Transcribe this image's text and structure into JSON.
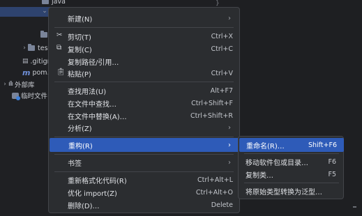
{
  "tree": {
    "rows": [
      {
        "label": "java"
      },
      {
        "label": ""
      },
      {
        "label": ""
      },
      {
        "label": "tes"
      },
      {
        "label": ".gitign"
      },
      {
        "label": "pom.x"
      },
      {
        "label": "外部库"
      },
      {
        "label": "临时文件"
      }
    ]
  },
  "editor": {
    "mark": "}"
  },
  "menu": {
    "new": {
      "label": "新建(N)"
    },
    "cut": {
      "label": "剪切(T)",
      "shortcut": "Ctrl+X"
    },
    "copy": {
      "label": "复制(C)",
      "shortcut": "Ctrl+C"
    },
    "copy_path": {
      "label": "复制路径/引用…"
    },
    "paste": {
      "label": "粘贴(P)",
      "shortcut": "Ctrl+V"
    },
    "find_usages": {
      "label": "查找用法(U)",
      "shortcut": "Alt+F7"
    },
    "find_in_files": {
      "label": "在文件中查找…",
      "shortcut": "Ctrl+Shift+F"
    },
    "replace_in_files": {
      "label": "在文件中替换(A)…",
      "shortcut": "Ctrl+Shift+R"
    },
    "analyze": {
      "label": "分析(Z)"
    },
    "refactor": {
      "label": "重构(R)"
    },
    "bookmarks": {
      "label": "书签"
    },
    "reformat": {
      "label": "重新格式化代码(R)",
      "shortcut": "Ctrl+Alt+L"
    },
    "optimize_imports": {
      "label": "优化 import(Z)",
      "shortcut": "Ctrl+Alt+O"
    },
    "delete": {
      "label": "删除(D)…",
      "shortcut": "Delete"
    }
  },
  "submenu": {
    "rename": {
      "label": "重命名(R)…",
      "shortcut": "Shift+F6"
    },
    "move": {
      "label": "移动软件包或目录…",
      "shortcut": "F6"
    },
    "copy_class": {
      "label": "复制类…",
      "shortcut": "F5"
    },
    "generify": {
      "label": "将原始类型转换为泛型…"
    }
  },
  "colors": {
    "menu_bg": "#2b2d30",
    "highlight": "#2e5bb8",
    "background": "#1e1f22"
  }
}
